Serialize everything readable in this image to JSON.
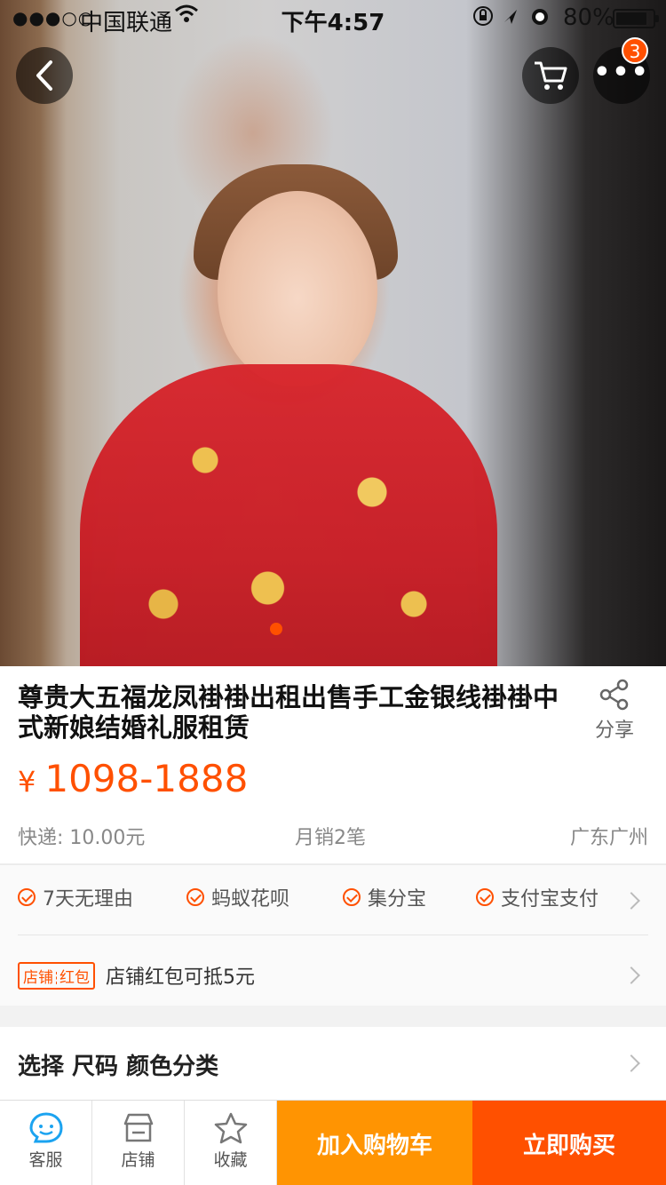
{
  "status_bar": {
    "signal": "●●●○○",
    "carrier": "中国联通",
    "time": "下午4:57",
    "battery": "80%"
  },
  "header": {
    "cart_badge": "3"
  },
  "product": {
    "title": "尊贵大五福龙凤褂褂出租出售手工金银线褂褂中式新娘结婚礼服租赁",
    "share_label": "分享",
    "currency": "¥",
    "price": "1098-1888",
    "shipping": "快递: 10.00元",
    "monthly_sales": "月销2笔",
    "location": "广东广州"
  },
  "services": {
    "items": [
      "7天无理由",
      "蚂蚁花呗",
      "集分宝",
      "支付宝支付"
    ],
    "coupon_tag_left": "店铺",
    "coupon_tag_right": "红包",
    "coupon_text": "店铺红包可抵5元"
  },
  "select": {
    "label": "选择  尺码 颜色分类"
  },
  "bottom_bar": {
    "service_label": "客服",
    "shop_label": "店铺",
    "favorite_label": "收藏",
    "add_to_cart": "加入购物车",
    "buy_now": "立即购买"
  },
  "colors": {
    "accent": "#ff5000",
    "cart_button": "#ff9402"
  }
}
